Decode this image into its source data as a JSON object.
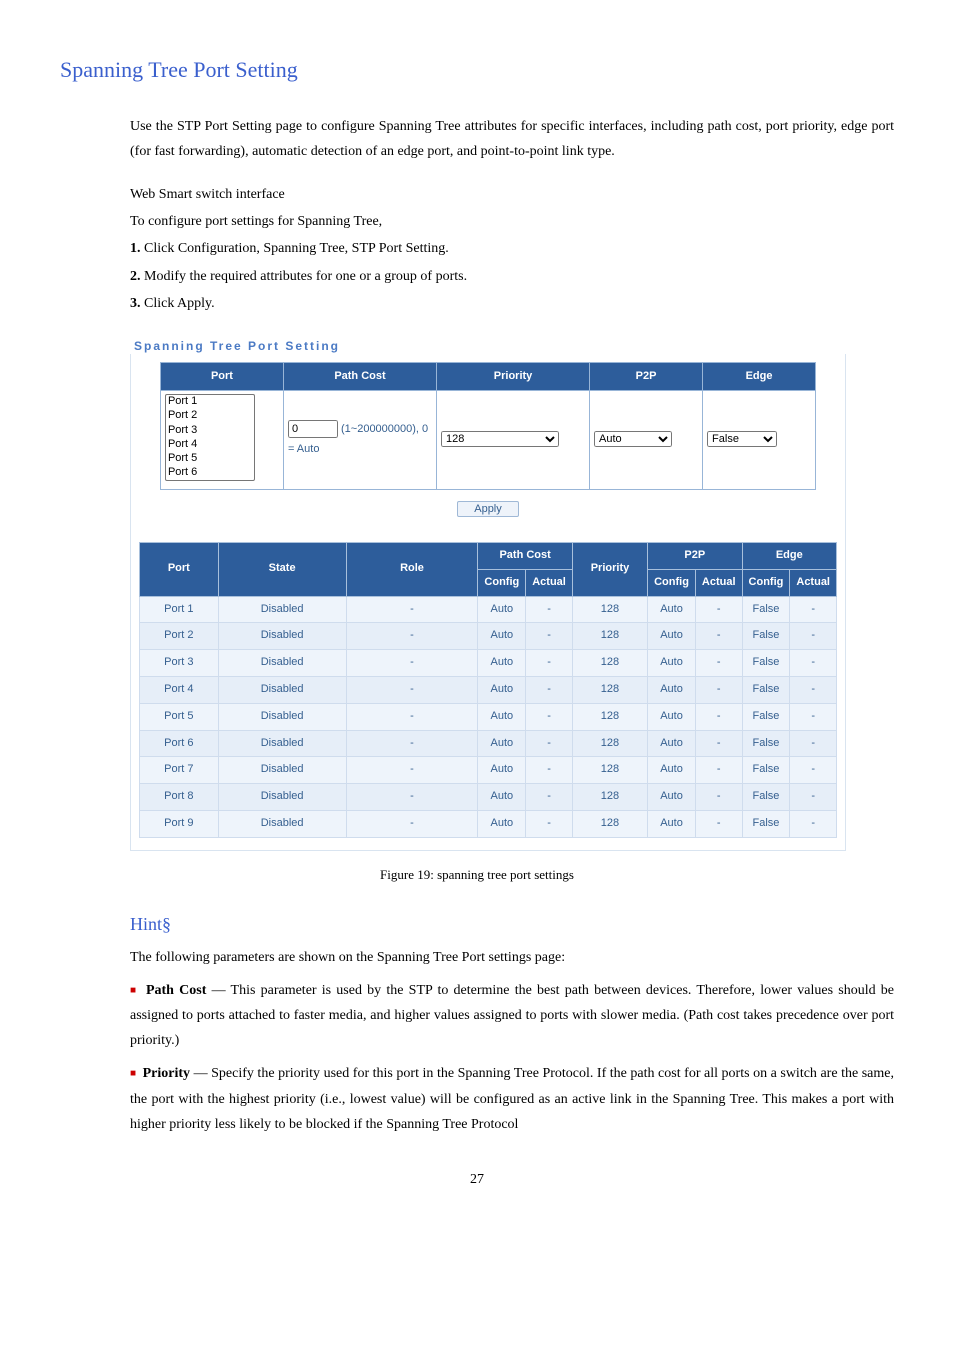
{
  "heading": "Spanning Tree Port Setting",
  "intro": "Use the STP Port Setting page to configure Spanning Tree attributes for specific interfaces, including path cost, port priority, edge port (for fast forwarding), automatic detection of an edge port, and point-to-point link type.",
  "instr_intro1": "Web Smart switch interface",
  "instr_intro2": "To configure port settings for Spanning Tree,",
  "step1_num": "1.",
  "step1_txt": " Click Configuration, Spanning Tree, STP Port Setting.",
  "step2_num": "2.",
  "step2_txt": " Modify the required attributes for one or a group of ports.",
  "step3_num": "3.",
  "step3_txt": " Click Apply.",
  "panel_title": "Spanning Tree Port Setting",
  "cfg": {
    "port_h": "Port",
    "pathcost_h": "Path Cost",
    "priority_h": "Priority",
    "p2p_h": "P2P",
    "edge_h": "Edge",
    "ports": [
      "Port 1",
      "Port 2",
      "Port 3",
      "Port 4",
      "Port 5",
      "Port 6"
    ],
    "pathcost_value": "0",
    "pathcost_note": "(1~200000000), 0 = Auto",
    "priority_value": "128",
    "p2p_value": "Auto",
    "edge_value": "False",
    "apply": "Apply"
  },
  "tbl": {
    "port_h": "Port",
    "state_h": "State",
    "role_h": "Role",
    "pc_h": "Path Cost",
    "pc_cfg": "Config",
    "pc_act": "Actual",
    "prio_h": "Priority",
    "p2p_h": "P2P",
    "p2p_cfg": "Config",
    "p2p_act": "Actual",
    "edge_h": "Edge",
    "edge_cfg": "Config",
    "edge_act": "Actual",
    "rows": [
      {
        "port": "Port 1",
        "state": "Disabled",
        "role": "-",
        "pc_cfg": "Auto",
        "pc_act": "-",
        "prio": "128",
        "p2p_cfg": "Auto",
        "p2p_act": "-",
        "e_cfg": "False",
        "e_act": "-"
      },
      {
        "port": "Port 2",
        "state": "Disabled",
        "role": "-",
        "pc_cfg": "Auto",
        "pc_act": "-",
        "prio": "128",
        "p2p_cfg": "Auto",
        "p2p_act": "-",
        "e_cfg": "False",
        "e_act": "-"
      },
      {
        "port": "Port 3",
        "state": "Disabled",
        "role": "-",
        "pc_cfg": "Auto",
        "pc_act": "-",
        "prio": "128",
        "p2p_cfg": "Auto",
        "p2p_act": "-",
        "e_cfg": "False",
        "e_act": "-"
      },
      {
        "port": "Port 4",
        "state": "Disabled",
        "role": "-",
        "pc_cfg": "Auto",
        "pc_act": "-",
        "prio": "128",
        "p2p_cfg": "Auto",
        "p2p_act": "-",
        "e_cfg": "False",
        "e_act": "-"
      },
      {
        "port": "Port 5",
        "state": "Disabled",
        "role": "-",
        "pc_cfg": "Auto",
        "pc_act": "-",
        "prio": "128",
        "p2p_cfg": "Auto",
        "p2p_act": "-",
        "e_cfg": "False",
        "e_act": "-"
      },
      {
        "port": "Port 6",
        "state": "Disabled",
        "role": "-",
        "pc_cfg": "Auto",
        "pc_act": "-",
        "prio": "128",
        "p2p_cfg": "Auto",
        "p2p_act": "-",
        "e_cfg": "False",
        "e_act": "-"
      },
      {
        "port": "Port 7",
        "state": "Disabled",
        "role": "-",
        "pc_cfg": "Auto",
        "pc_act": "-",
        "prio": "128",
        "p2p_cfg": "Auto",
        "p2p_act": "-",
        "e_cfg": "False",
        "e_act": "-"
      },
      {
        "port": "Port 8",
        "state": "Disabled",
        "role": "-",
        "pc_cfg": "Auto",
        "pc_act": "-",
        "prio": "128",
        "p2p_cfg": "Auto",
        "p2p_act": "-",
        "e_cfg": "False",
        "e_act": "-"
      },
      {
        "port": "Port 9",
        "state": "Disabled",
        "role": "-",
        "pc_cfg": "Auto",
        "pc_act": "-",
        "prio": "128",
        "p2p_cfg": "Auto",
        "p2p_act": "-",
        "e_cfg": "False",
        "e_act": "-"
      }
    ]
  },
  "fig_caption": "Figure 19: spanning tree port settings",
  "hint_heading": "Hint§",
  "hint_intro": "The following parameters are shown on the Spanning Tree Port settings page:",
  "hint_pathcost_label": "Path Cost",
  "hint_pathcost_body": " — This parameter is used by the STP to determine the best path between devices. Therefore, lower values should be assigned to ports attached to faster media, and higher values assigned to ports with slower media. (Path cost takes precedence over port priority.)",
  "hint_priority_label": "Priority",
  "hint_priority_body": " — Specify the priority used for this port in the Spanning Tree Protocol. If the path cost for all ports on a switch are the same, the port with the highest priority (i.e., lowest value) will be configured as an active link in the Spanning Tree. This makes a port with higher priority less likely to be blocked if the Spanning Tree Protocol",
  "page_num": "27"
}
